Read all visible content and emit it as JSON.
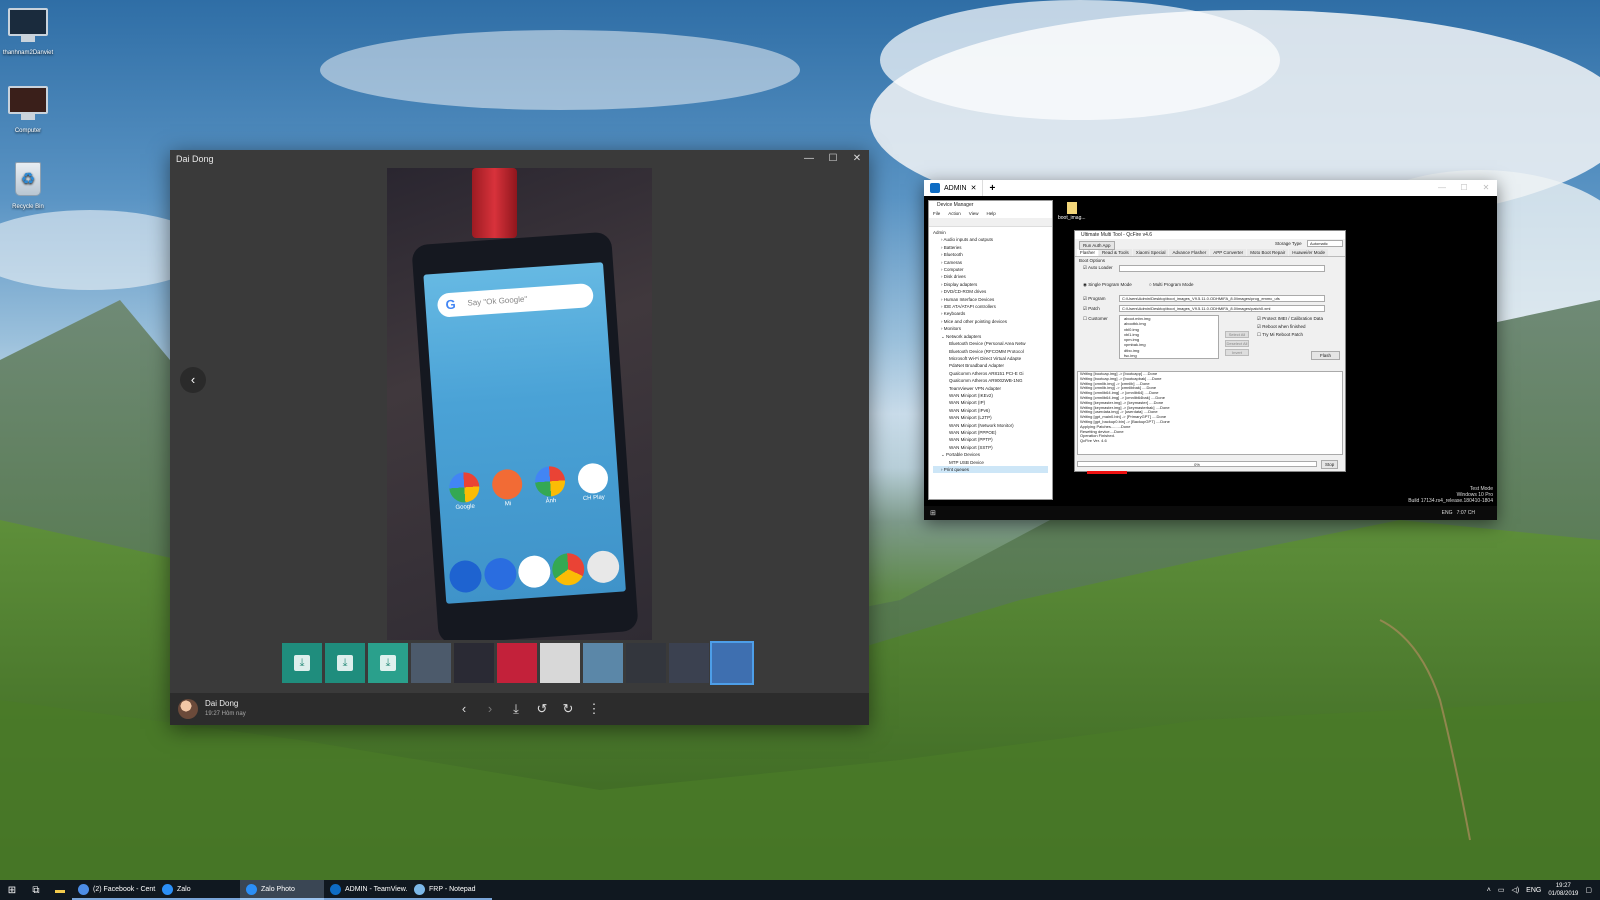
{
  "desktop": {
    "icons": [
      {
        "label": "thanhnam2Danviet",
        "icon": "monitor-icon"
      },
      {
        "label": "Computer",
        "icon": "computer-icon"
      },
      {
        "label": "Recycle Bin",
        "icon": "recycle-bin-icon"
      }
    ]
  },
  "zalo_photo": {
    "title": "Dai Dong",
    "controls": {
      "minimize": "—",
      "maximize": "☐",
      "close": "✕"
    },
    "prev_arrow": "‹",
    "phone_screen": {
      "search_hint": "Say \"Ok Google\"",
      "apps_row": [
        "Google",
        "Mi",
        "Ảnh",
        "CH Play"
      ]
    },
    "thumbnail_count": 11,
    "sender_name": "Dai Dong",
    "sent_time": "19:27 Hôm nay",
    "toolbar": {
      "prev": "‹",
      "next": "›",
      "download": "⤓",
      "rotate_left": "↺",
      "rotate_right": "↻",
      "more": "⋮"
    }
  },
  "teamviewer": {
    "tab_label": "ADMIN",
    "tab_close": "✕",
    "new_tab": "+",
    "device_manager": {
      "title": "Device Manager",
      "menu": [
        "File",
        "Action",
        "View",
        "Help"
      ],
      "root": "Admin",
      "categories": [
        "Audio inputs and outputs",
        "Batteries",
        "Bluetooth",
        "Cameras",
        "Computer",
        "Disk drives",
        "Display adapters",
        "DVD/CD-ROM drives",
        "Human Interface Devices",
        "IDE ATA/ATAPI controllers",
        "Keyboards",
        "Mice and other pointing devices",
        "Monitors"
      ],
      "network_header": "Network adapters",
      "network_items": [
        "Bluetooth Device (Personal Area Netw",
        "Bluetooth Device (RFCOMM Protocol",
        "Microsoft Wi-Fi Direct Virtual Adapte",
        "PdaNet Broadband Adapter",
        "Qualcomm Atheros AR8151 PCI-E Gi",
        "Qualcomm Atheros AR9002WB-1NG",
        "TeamViewer VPN Adapter",
        "WAN Miniport (IKEv2)",
        "WAN Miniport (IP)",
        "WAN Miniport (IPv6)",
        "WAN Miniport (L2TP)",
        "WAN Miniport (Network Monitor)",
        "WAN Miniport (PPPOE)",
        "WAN Miniport (PPTP)",
        "WAN Miniport (SSTP)"
      ],
      "portable_header": "Portable Devices",
      "portable_items": [
        "MTP USB Device"
      ],
      "last_item": "Print queues"
    },
    "desktop_file": "boot_imag...",
    "umt": {
      "title": "Ultimate Multi Tool - QcFire v4.6",
      "run_auth": "Run Auth App",
      "storage_label": "Storage Type",
      "storage_value": "Automatic",
      "tabs": [
        "Flasher",
        "Read & Tools",
        "Xiaomi Special",
        "Advance Flasher",
        "APP Converter",
        "Moto Boot Repair",
        "Huawei/er Mode"
      ],
      "boot_options": "Boot Options",
      "auto_loader": "Auto Loader",
      "single_mode": "Single Program Mode",
      "multi_mode": "Multi Program Mode",
      "program_label": "Program",
      "program_path": "C:\\Users\\Admin\\Desktop\\boot_images_V9.5.11.0.ODHMIFA_8.0\\images\\prog_emmc_ufs",
      "patch_label": "Patch",
      "patch_path": "C:\\Users\\Admin\\Desktop\\boot_images_V9.5.11.0.ODHMIFA_8.0\\images\\patch0.xml",
      "customer_label": "Customer",
      "image_list": [
        "aboot.mbn.img",
        "abootbk.img",
        "xbl0.img",
        "xbl1.img",
        "xpm.img",
        "xpmbak.img",
        "dtbo.img",
        "fsc.img"
      ],
      "options": [
        "Protect IMEI / Calibration Data",
        "Reboot when finished",
        "Try Mi Reboot Patch"
      ],
      "side_buttons": [
        "Select All",
        "Deselect All",
        "Invert"
      ],
      "flash_button": "Flash",
      "log": [
        "Writing [bootcap.img] -> [bootcapp] ....Done",
        "Writing [bootcap.img] -> [bootcapbak] ....Done",
        "Writing [cmnlib.img] -> [cmnlib] ....Done",
        "Writing [cmnlib.img] -> [cmnlibbak] ....Done",
        "Writing [cmnlib64.img] -> [cmnlib64] ....Done",
        "Writing [cmnlib64.img] -> [cmnlib64bak] ....Done",
        "Writing [keymaster.img] -> [keymaster] ....Done",
        "Writing [keymaster.img] -> [keymasterbak] ....Done",
        "Writing [userdata.img] -> [userdata] ....Done",
        "Writing [gpt_main0.bin] -> [PrimaryGPT] ....Done",
        "Writing [gpt_backup0.bin] -> [BackupGPT] ....Done",
        "Applying Patches.........Done",
        "Resetting device....Done",
        "Operation Finished.",
        "QcFire Ver. 4.6"
      ],
      "progress_text": "0%",
      "stop_button": "Stop"
    },
    "remote_taskbar": {
      "lang": "ENG",
      "time": "7:07 CH"
    },
    "watermark": [
      "Test Mode",
      "Windows 10 Pro",
      "Build 17134.rs4_release.180410-1804"
    ]
  },
  "taskbar": {
    "start_icon": "windows-start-icon",
    "apps": [
      {
        "label": "(2) Facebook - Cent...",
        "color": "#4d8de6",
        "state": "open"
      },
      {
        "label": "Zalo",
        "color": "#2b8ff7",
        "state": "open"
      },
      {
        "label": "Zalo Photo",
        "color": "#2b8ff7",
        "state": "active"
      },
      {
        "label": "ADMIN - TeamView...",
        "color": "#0e6cc4",
        "state": "open"
      },
      {
        "label": "FRP - Notepad",
        "color": "#7cb8e8",
        "state": "open"
      }
    ],
    "tray": {
      "lang": "ENG",
      "time": "19:27",
      "date": "01/08/2019"
    }
  }
}
